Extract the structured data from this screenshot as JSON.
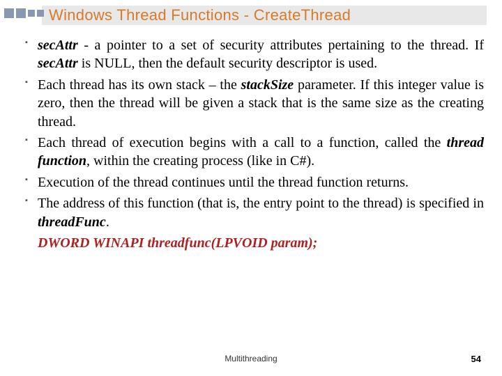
{
  "slide": {
    "title": "Windows Thread Functions - CreateThread",
    "bullets": {
      "b1_a": "secAttr",
      "b1_b": "  - a pointer to a set of security attributes pertaining to the thread. If ",
      "b1_c": "secAttr",
      "b1_d": " is NULL, then the default security descriptor is used.",
      "b2_a": "Each thread has its own stack – the ",
      "b2_b": "stackSize",
      "b2_c": " parameter. If this integer value is zero, then the thread will be given a stack that is the same size as the creating thread.",
      "b3_a": "Each thread of execution begins with a call to a function, called the ",
      "b3_b": "thread function",
      "b3_c": ", within the creating process (like in C#).",
      "b4": "Execution of the thread continues until the thread function returns.",
      "b5_a": "The address of this function (that is, the entry point to the thread) is specified in ",
      "b5_b": "threadFunc",
      "b5_c": ".",
      "signature": "DWORD WINAPI threadfunc(LPVOID param);"
    },
    "footer_center": "Multithreading",
    "page_number": "54"
  }
}
